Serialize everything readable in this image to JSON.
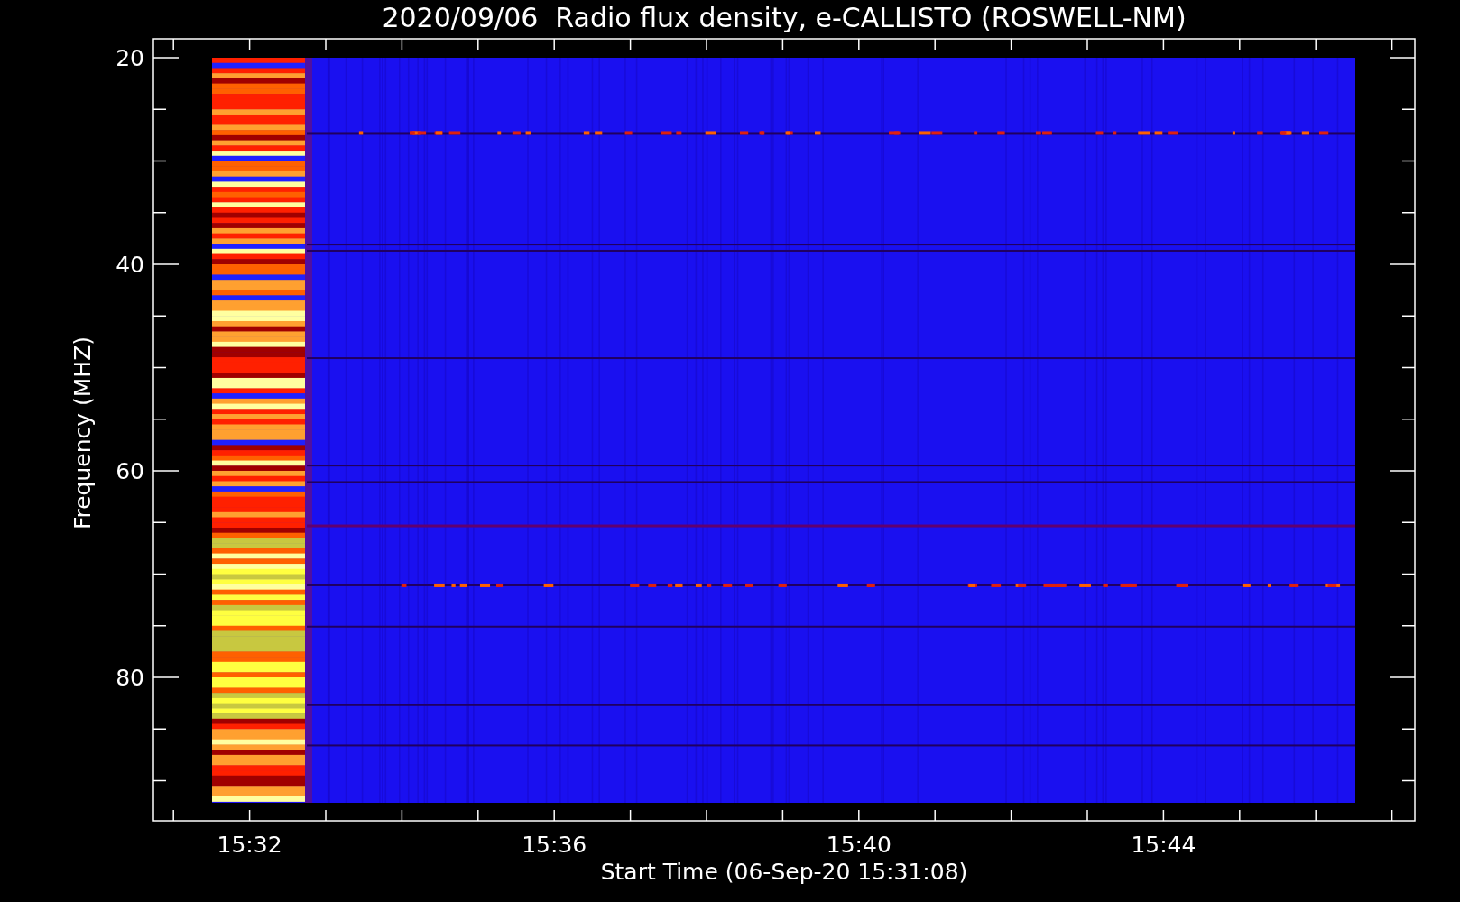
{
  "title": "2020/09/06  Radio flux density, e-CALLISTO (ROSWELL-NM)",
  "y_axis": {
    "title": "Frequency (MHZ)",
    "tick_labels": [
      "20",
      "40",
      "60",
      "80"
    ]
  },
  "x_axis": {
    "title": "Start Time (06-Sep-20 15:31:08)",
    "tick_labels": [
      "15:32",
      "15:36",
      "15:40",
      "15:44"
    ]
  }
}
